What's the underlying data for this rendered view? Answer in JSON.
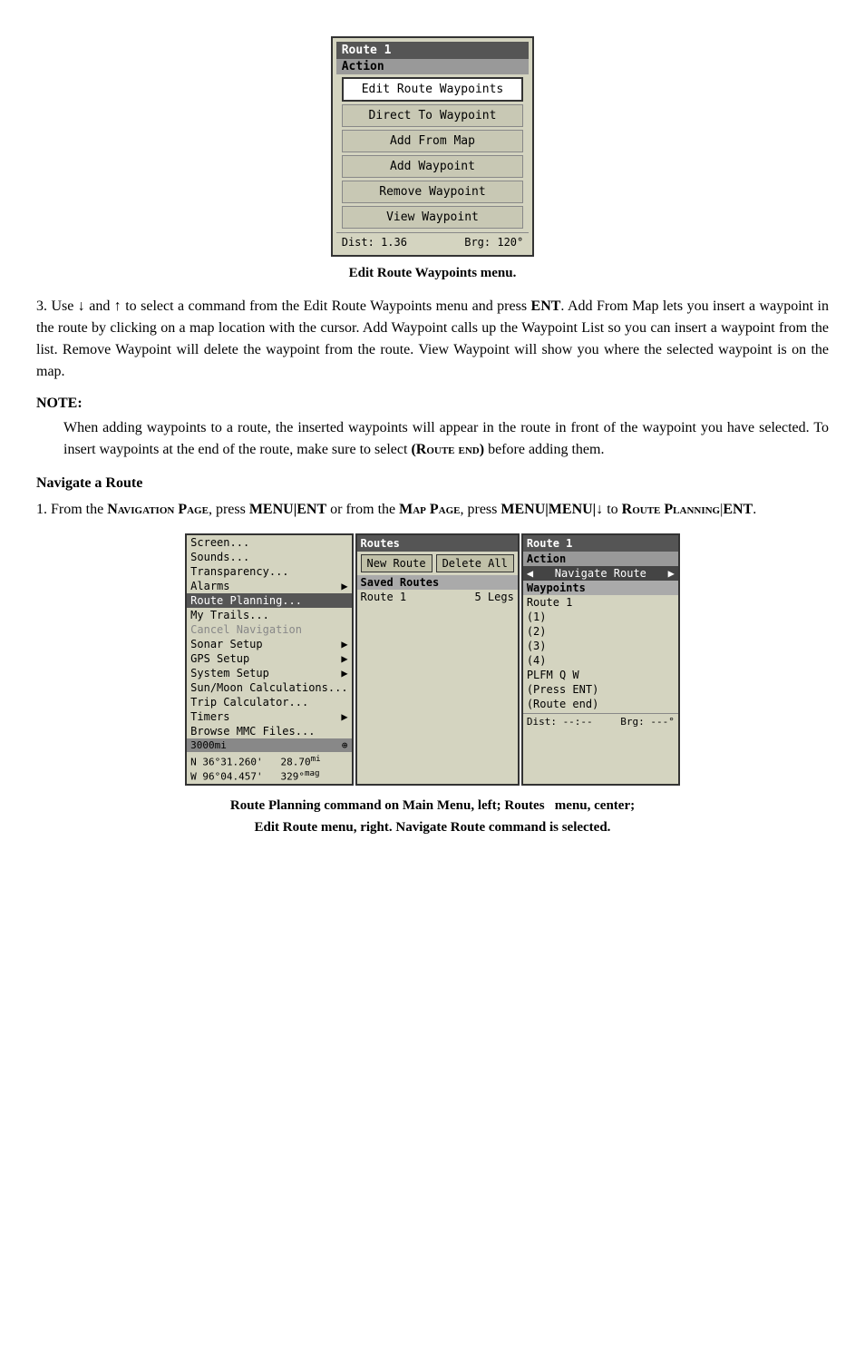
{
  "top_screenshot": {
    "title": "Route 1",
    "action_label": "Action",
    "menu_items": [
      {
        "label": "Edit Route Waypoints",
        "highlighted": true
      },
      {
        "label": "Direct To Waypoint",
        "highlighted": false
      },
      {
        "label": "Add From Map",
        "highlighted": false
      },
      {
        "label": "Add Waypoint",
        "highlighted": false
      },
      {
        "label": "Remove Waypoint",
        "highlighted": false
      },
      {
        "label": "View Waypoint",
        "highlighted": false
      }
    ],
    "status_dist": "Dist: 1.36",
    "status_brg": "Brg: 120°"
  },
  "top_caption": "Edit Route Waypoints menu.",
  "paragraph1": "3. Use ↓ and ↑ to select a command from the Edit Route Waypoints menu and press ENT. Add From Map lets you insert a waypoint in the route by clicking on a map location with the cursor. Add Waypoint calls up the Waypoint List so you can insert a waypoint from the list. Remove Waypoint will delete the waypoint from the route. View Waypoint will show you where the selected waypoint is on the map.",
  "note_heading": "NOTE:",
  "note_text": "When adding waypoints to a route, the inserted waypoints will appear in the route in front of the waypoint you have selected. To insert waypoints at the end of the route, make sure to select (Route End) before adding them.",
  "section_heading": "Navigate a Route",
  "paragraph2_parts": {
    "pre": "1. From the ",
    "nav_page": "Navigation Page",
    "mid1": ", press ",
    "menu_ent": "MENU|ENT",
    "mid2": " or from the ",
    "map_page": "Map Page",
    "mid3": ", press ",
    "menu_seq": "MENU|MENU|↓",
    "mid4": " to ",
    "route_planning": "Route Planning",
    "end": "|ENT."
  },
  "left_panel": {
    "items": [
      {
        "label": "Screen...",
        "selected": false,
        "disabled": false,
        "arrow": false
      },
      {
        "label": "Sounds...",
        "selected": false,
        "disabled": false,
        "arrow": false
      },
      {
        "label": "Transparency...",
        "selected": false,
        "disabled": false,
        "arrow": false
      },
      {
        "label": "Alarms",
        "selected": false,
        "disabled": false,
        "arrow": true
      },
      {
        "label": "Route Planning...",
        "selected": true,
        "disabled": false,
        "arrow": false
      },
      {
        "label": "My Trails...",
        "selected": false,
        "disabled": false,
        "arrow": false
      },
      {
        "label": "Cancel Navigation",
        "selected": false,
        "disabled": true,
        "arrow": false
      },
      {
        "label": "Sonar Setup",
        "selected": false,
        "disabled": false,
        "arrow": true
      },
      {
        "label": "GPS Setup",
        "selected": false,
        "disabled": false,
        "arrow": true
      },
      {
        "label": "System Setup",
        "selected": false,
        "disabled": false,
        "arrow": true
      },
      {
        "label": "Sun/Moon Calculations...",
        "selected": false,
        "disabled": false,
        "arrow": false
      },
      {
        "label": "Trip Calculator...",
        "selected": false,
        "disabled": false,
        "arrow": false
      },
      {
        "label": "Timers",
        "selected": false,
        "disabled": false,
        "arrow": true
      },
      {
        "label": "Browse MMC Files...",
        "selected": false,
        "disabled": false,
        "arrow": false
      }
    ],
    "bottom_bar": "3000mi",
    "coord_n": "N  36°31.260'",
    "coord_dist": "28.70mi",
    "coord_w": "W  96°04.457'",
    "coord_mag": "329° mag"
  },
  "center_panel": {
    "title": "Routes",
    "btn_new": "New Route",
    "btn_delete": "Delete All",
    "saved_label": "Saved Routes",
    "route_name": "Route 1",
    "route_legs": "5 Legs"
  },
  "right_panel": {
    "title": "Route 1",
    "action_label": "Action",
    "nav_route_label": "Navigate Route",
    "waypoints_label": "Waypoints",
    "waypoints_items": [
      "Route 1",
      "(1)",
      "(2)",
      "(3)",
      "(4)",
      "PLFM Q W",
      "(Press ENT)",
      "(Route end)"
    ],
    "status_dist": "Dist: --:--",
    "status_brg": "Brg: ---°"
  },
  "bottom_caption": "Route Planning command on Main Menu, left; Routes  menu, center;\nEdit Route menu, right. Navigate Route command is selected."
}
